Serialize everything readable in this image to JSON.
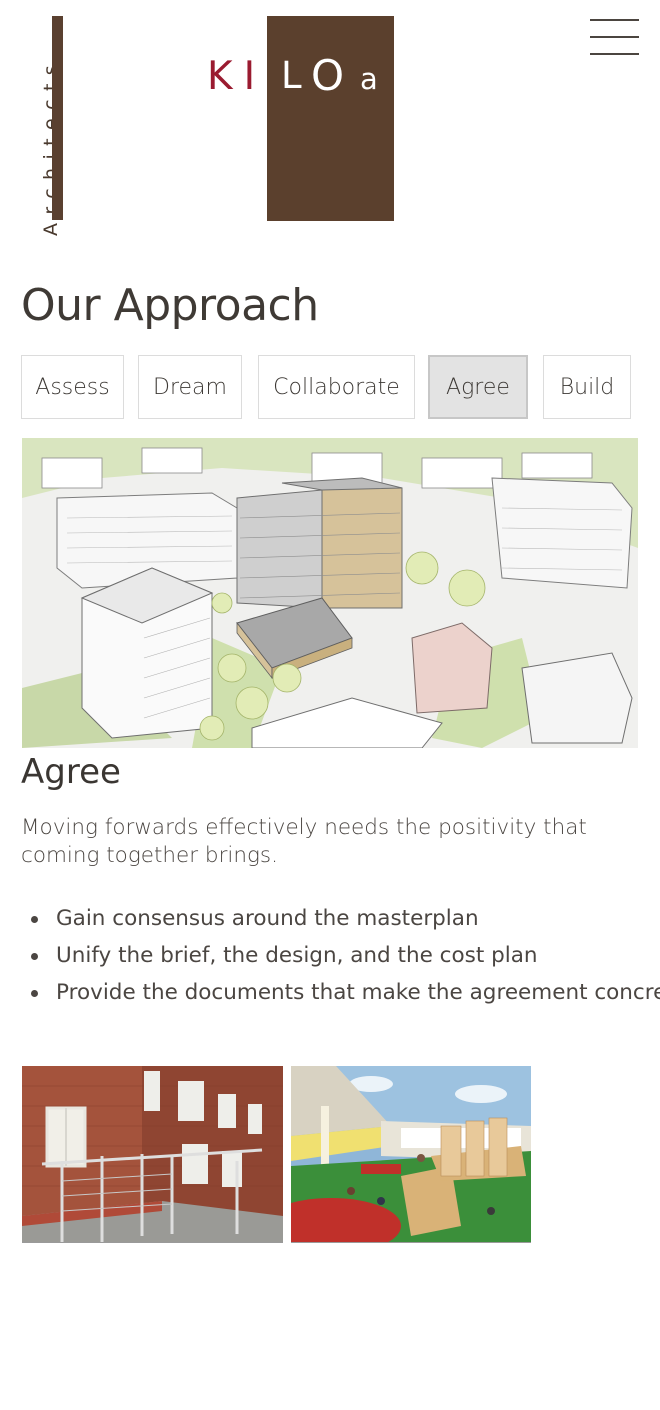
{
  "header": {
    "logo_side_text": "Architects",
    "logo_ki": "KI",
    "logo_l": "L",
    "logo_o": "O",
    "logo_a": "a",
    "menu_icon": "hamburger-menu-icon"
  },
  "page": {
    "title": "Our Approach"
  },
  "tabs": [
    {
      "label": "Assess",
      "active": false
    },
    {
      "label": "Dream",
      "active": false
    },
    {
      "label": "Collaborate",
      "active": false
    },
    {
      "label": "Agree",
      "active": true
    },
    {
      "label": "Build",
      "active": false
    }
  ],
  "section": {
    "title": "Agree",
    "description": "Moving forwards effectively needs the positivity that coming together brings.",
    "bullets": [
      "Gain consensus around the masterplan",
      "Unify the brief, the design, and the cost plan",
      "Provide the documents that make the agreement concrete"
    ]
  },
  "colors": {
    "brand_brown": "#5b402d",
    "brand_red": "#9a1b30",
    "text": "#3d3935",
    "tab_active_bg": "#e3e3e3",
    "tab_border": "#dcdcdc"
  }
}
